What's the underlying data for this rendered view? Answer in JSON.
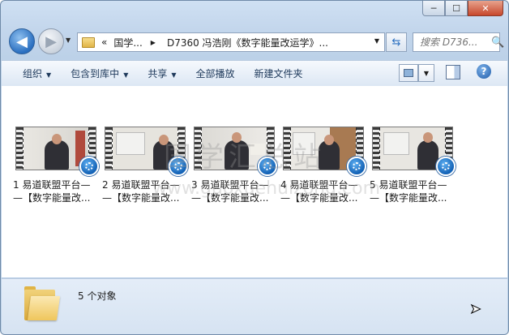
{
  "window": {
    "minimize": "─",
    "maximize": "☐",
    "close": "✕"
  },
  "nav": {
    "back_glyph": "◀",
    "forward_glyph": "▶",
    "address": {
      "prefix": "«",
      "crumb1": "国学...",
      "sep": "▶",
      "crumb2": "D7360 冯浩刚《数字能量改运学》..."
    },
    "refresh_glyph": "⇆",
    "search_placeholder": "搜索 D736...",
    "search_icon": "🔍"
  },
  "toolbar": {
    "organize": "组织",
    "include_library": "包含到库中",
    "share": "共享",
    "play_all": "全部播放",
    "new_folder": "新建文件夹",
    "help": "?"
  },
  "files": [
    {
      "line1": "1 易道联盟平台—",
      "line2": "—【数字能量改..."
    },
    {
      "line1": "2 易道联盟平台—",
      "line2": "—【数字能量改..."
    },
    {
      "line1": "3 易道联盟平台—",
      "line2": "—【数字能量改..."
    },
    {
      "line1": "4 易道联盟平台—",
      "line2": "—【数字能量改..."
    },
    {
      "line1": "5 易道联盟平台—",
      "line2": "—【数字能量改..."
    }
  ],
  "watermark": {
    "text": "国学汇总站",
    "url": "www.guoxuehuizong.com"
  },
  "status": {
    "count": "5 个对象"
  },
  "icons": {
    "back": "arrow-left",
    "forward": "arrow-right",
    "search": "magnifier",
    "video": "media-player-badge",
    "folder": "folder",
    "help": "question-mark"
  }
}
